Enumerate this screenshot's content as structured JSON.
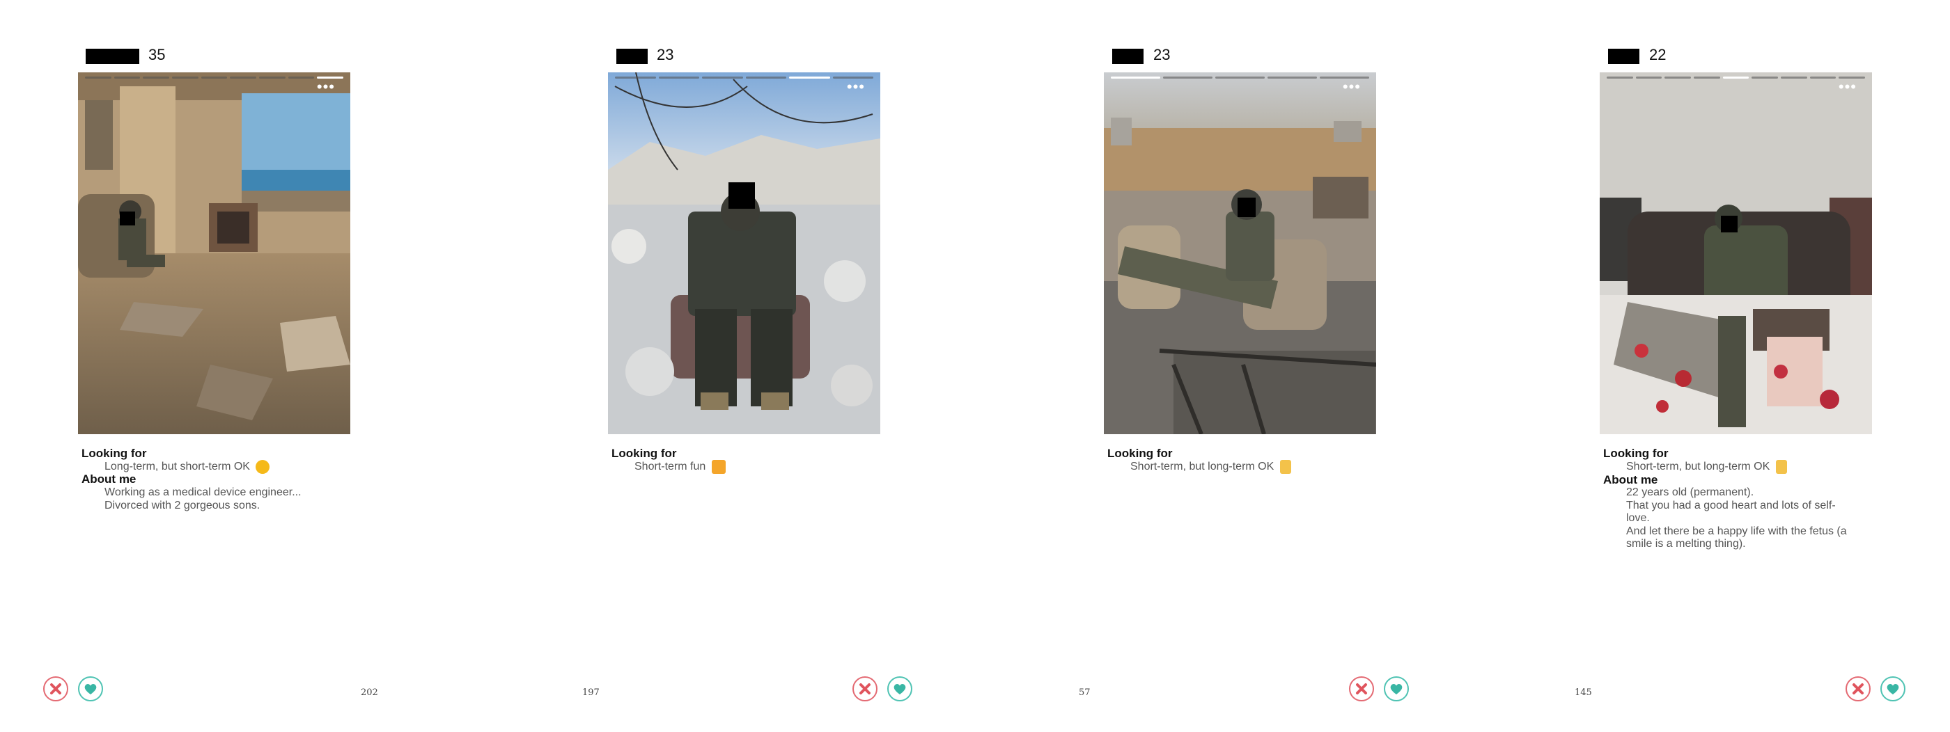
{
  "colors": {
    "nope": "#e0545d",
    "like": "#39b6a4"
  },
  "cards": [
    {
      "age": "35",
      "looking_for_label": "Looking for",
      "looking_for": "Long-term, but short-term OK",
      "looking_for_emoji": "heart-eyes-emoji",
      "about_label": "About me",
      "about_lines": [
        "Working as a medical device engineer...",
        "Divorced with 2 gorgeous sons."
      ],
      "count": "202"
    },
    {
      "age": "23",
      "looking_for_label": "Looking for",
      "looking_for": "Short-term fun",
      "looking_for_emoji": "party-popper-emoji",
      "count": "197"
    },
    {
      "age": "23",
      "looking_for_label": "Looking for",
      "looking_for": "Short-term, but long-term OK",
      "looking_for_emoji": "clinking-glasses-emoji",
      "count": "57"
    },
    {
      "age": "22",
      "looking_for_label": "Looking for",
      "looking_for": "Short-term, but long-term OK",
      "looking_for_emoji": "clinking-glasses-emoji",
      "about_label": "About me",
      "about_lines": [
        "22 years old (permanent).",
        "That you had a good heart and lots of self-",
        "love.",
        "And let there be a happy life with the fetus (a",
        "smile is a melting thing)."
      ],
      "count": "145"
    }
  ]
}
